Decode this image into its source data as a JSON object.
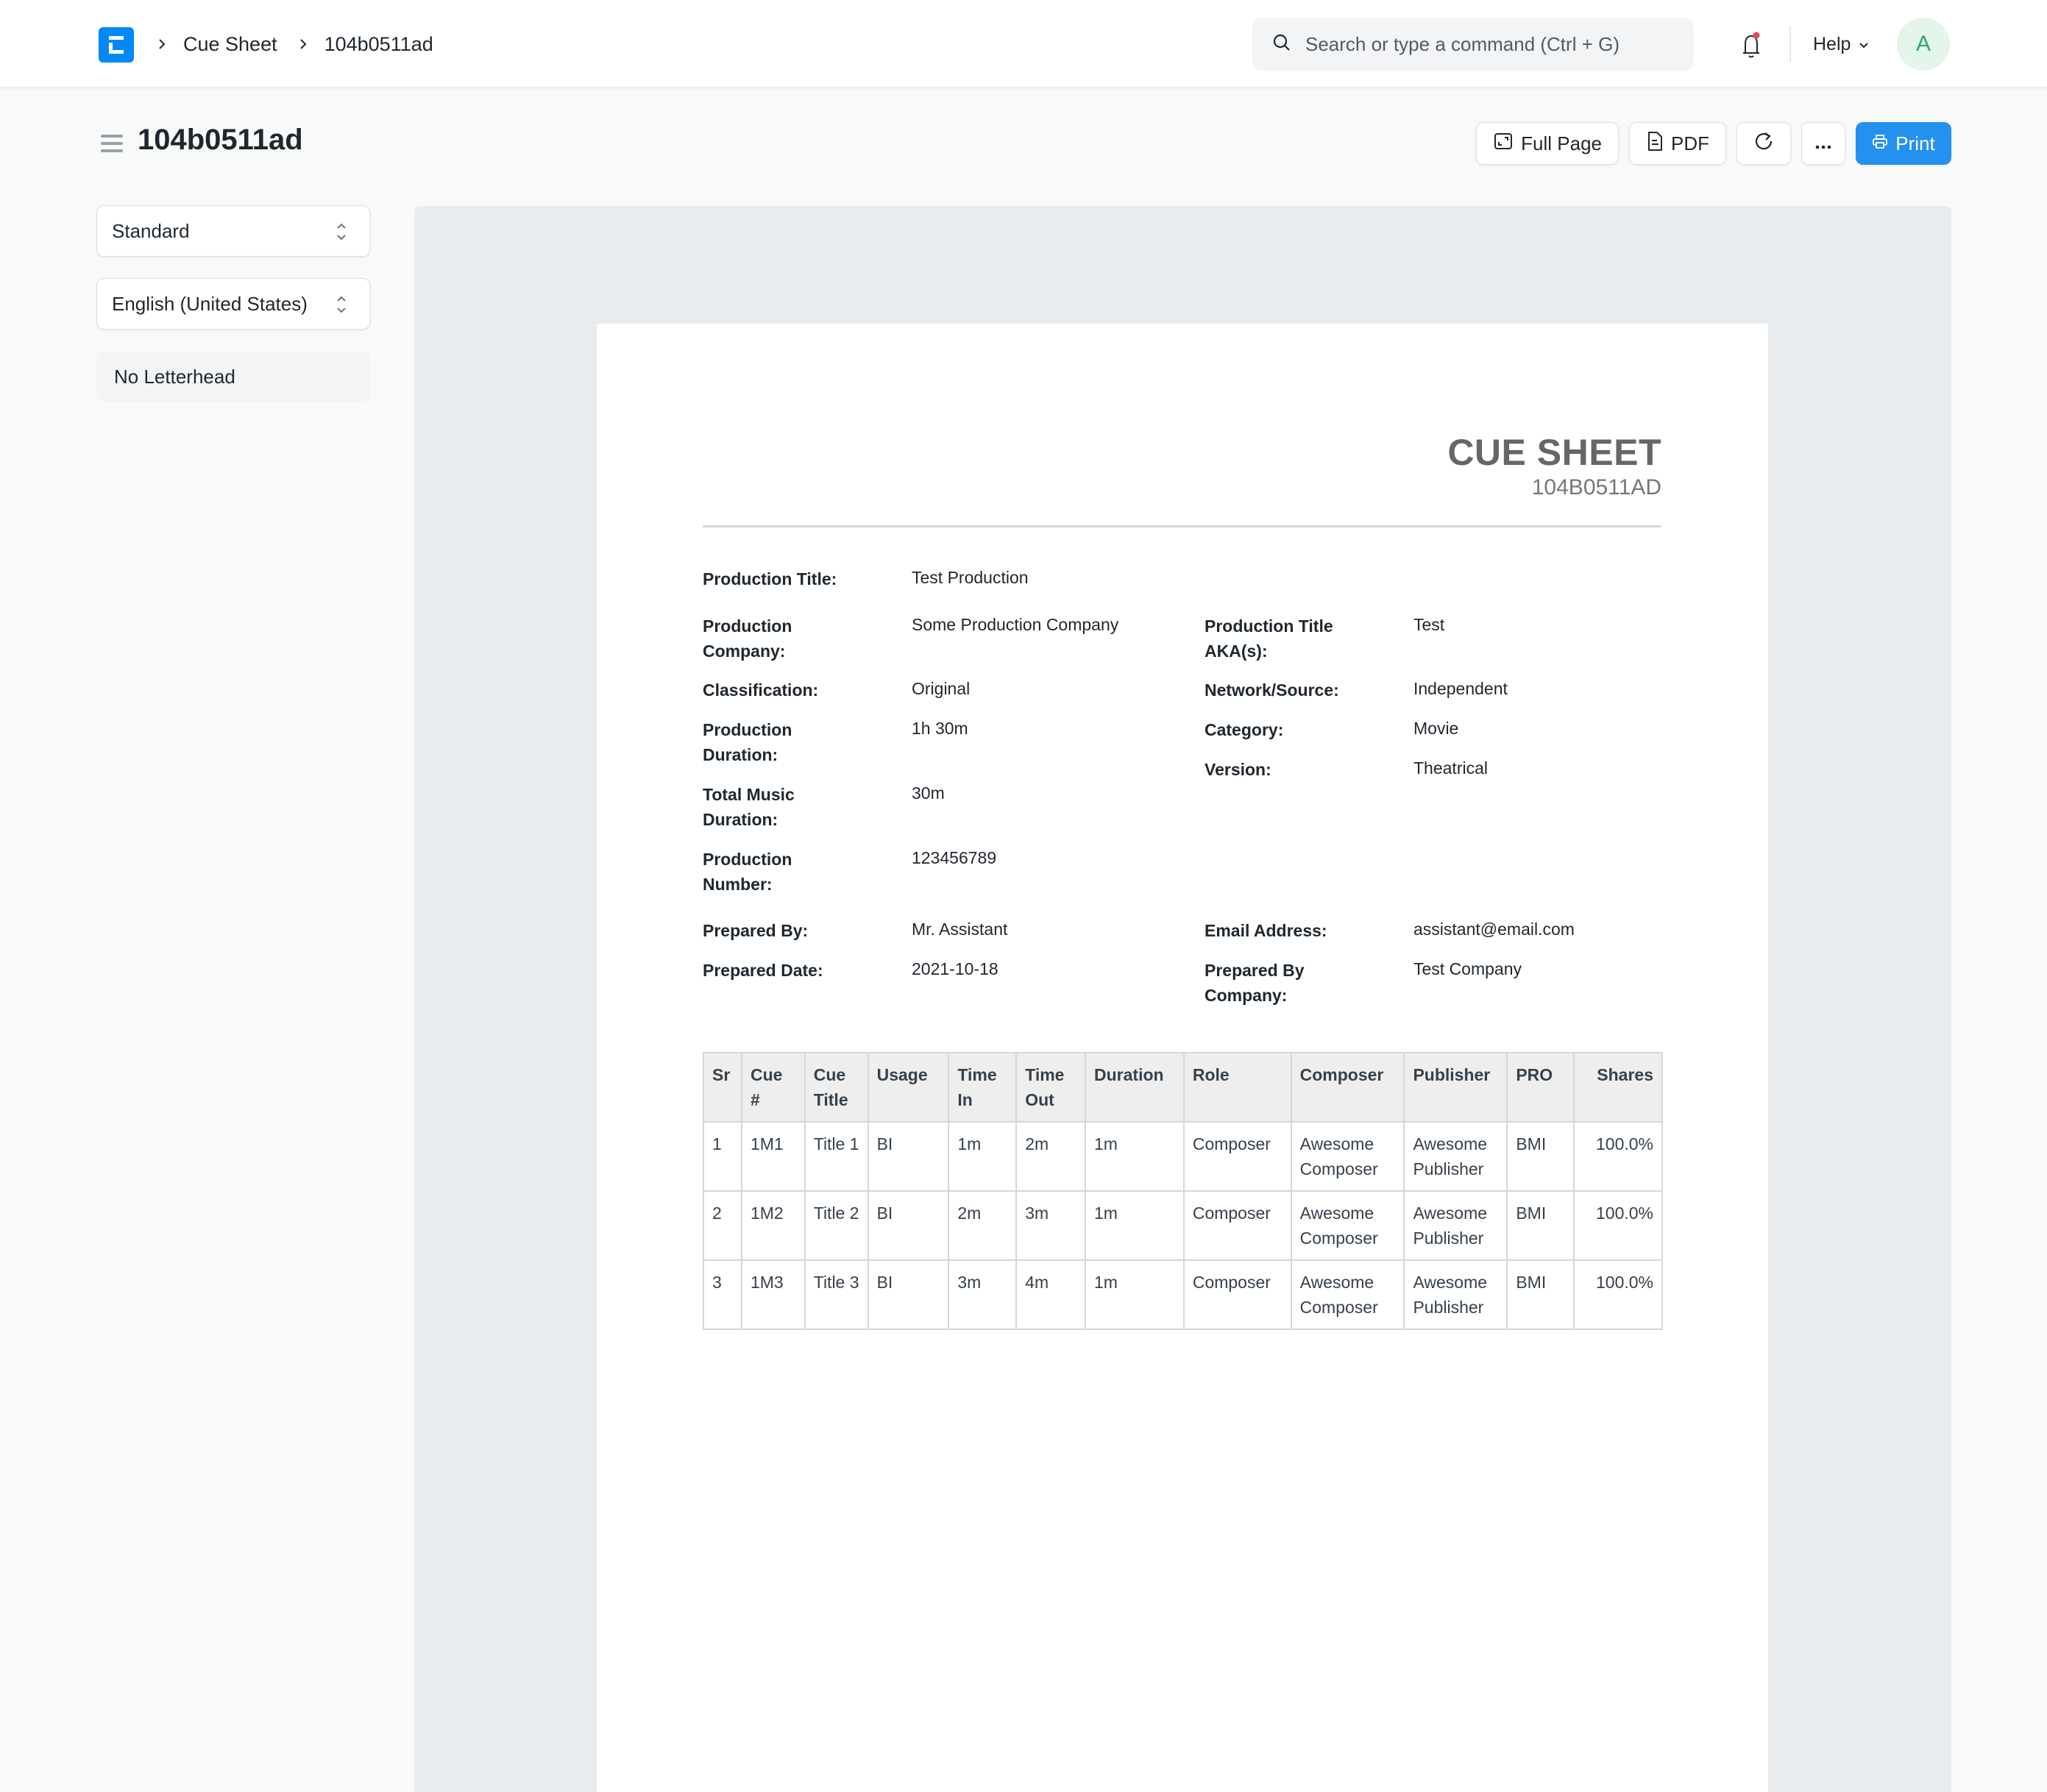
{
  "navbar": {
    "logo_icon": "erpnext-logo",
    "breadcrumbs": [
      "Cue Sheet",
      "104b0511ad"
    ],
    "search_placeholder": "Search or type a command (Ctrl + G)",
    "help_label": "Help",
    "avatar_initial": "A",
    "notification_dot_color": "#e24c4c"
  },
  "page": {
    "title": "104b0511ad",
    "actions": {
      "full_page": "Full Page",
      "pdf": "PDF",
      "print": "Print"
    },
    "accent_color": "#2490ef"
  },
  "sidebar": {
    "print_format": "Standard",
    "language": "English (United States)",
    "letterhead": "No Letterhead"
  },
  "document": {
    "heading": "CUE SHEET",
    "subheading": "104B0511AD",
    "fields": {
      "production_title": {
        "label": "Production Title:",
        "value": "Test Production"
      },
      "production_company": {
        "label": "Production Company:",
        "value": "Some Production Company"
      },
      "production_title_aka": {
        "label": "Production Title AKA(s):",
        "value": "Test"
      },
      "classification": {
        "label": "Classification:",
        "value": "Original"
      },
      "network_source": {
        "label": "Network/Source:",
        "value": "Independent"
      },
      "production_duration": {
        "label": "Production Duration:",
        "value": "1h 30m"
      },
      "category": {
        "label": "Category:",
        "value": "Movie"
      },
      "version": {
        "label": "Version:",
        "value": "Theatrical"
      },
      "total_music_duration": {
        "label": "Total Music Duration:",
        "value": "30m"
      },
      "production_number": {
        "label": "Production Number:",
        "value": "123456789"
      },
      "prepared_by": {
        "label": "Prepared By:",
        "value": "Mr. Assistant"
      },
      "email_address": {
        "label": "Email Address:",
        "value": "assistant@email.com"
      },
      "prepared_date": {
        "label": "Prepared Date:",
        "value": "2021-10-18"
      },
      "prepared_by_company": {
        "label": "Prepared By Company:",
        "value": "Test Company"
      }
    },
    "table": {
      "headers": [
        "Sr",
        "Cue #",
        "Cue Title",
        "Usage",
        "Time In",
        "Time Out",
        "Duration",
        "Role",
        "Composer",
        "Publisher",
        "PRO",
        "Shares"
      ],
      "rows": [
        [
          "1",
          "1M1",
          "Title 1",
          "BI",
          "1m",
          "2m",
          "1m",
          "Composer",
          "Awesome Composer",
          "Awesome Publisher",
          "BMI",
          "100.0%"
        ],
        [
          "2",
          "1M2",
          "Title 2",
          "BI",
          "2m",
          "3m",
          "1m",
          "Composer",
          "Awesome Composer",
          "Awesome Publisher",
          "BMI",
          "100.0%"
        ],
        [
          "3",
          "1M3",
          "Title 3",
          "BI",
          "3m",
          "4m",
          "1m",
          "Composer",
          "Awesome Composer",
          "Awesome Publisher",
          "BMI",
          "100.0%"
        ]
      ]
    }
  }
}
